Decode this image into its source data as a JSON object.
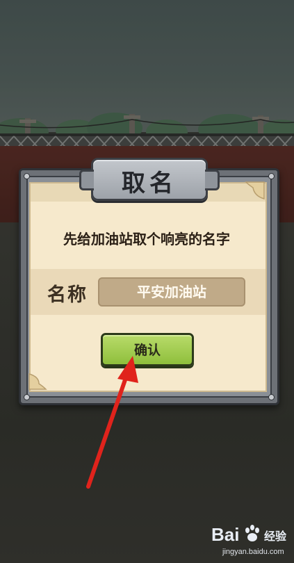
{
  "dialog": {
    "title": "取名",
    "prompt": "先给加油站取个响亮的名字",
    "name_label": "名称",
    "name_value": "平安加油站",
    "confirm_label": "确认"
  },
  "watermark": {
    "logo": "Bai",
    "brand": "经验",
    "url": "jingyan.baidu.com"
  },
  "colors": {
    "confirm_button": "#a6cf55",
    "paper": "#f6e9cc",
    "frame": "#6d7177",
    "arrow": "#e0231c",
    "wall": "#5a2e27"
  },
  "icons": {
    "annotation": "red-arrow-icon",
    "brand": "paw-icon"
  }
}
